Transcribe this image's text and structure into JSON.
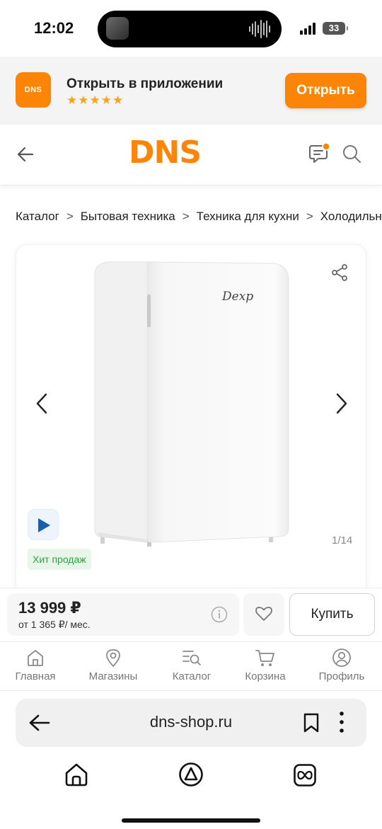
{
  "status_bar": {
    "time": "12:02",
    "battery": "33"
  },
  "app_banner": {
    "logo_text": "DNS",
    "title": "Открыть в приложении",
    "stars": "★★★★★",
    "open_button": "Открыть",
    "accent_color": "#fc8507"
  },
  "header": {
    "brand": "DNS",
    "icons": [
      "back-arrow-icon",
      "chat-icon",
      "search-icon"
    ]
  },
  "breadcrumb": [
    "Каталог",
    "Бытовая техника",
    "Техника для кухни",
    "Холодильное"
  ],
  "product": {
    "image_logo": "Dexp",
    "counter": "1/14",
    "badge": "Хит продаж",
    "price": "13 999 ₽",
    "installment": "от 1 365 ₽/ мес.",
    "buy_button": "Купить"
  },
  "bottom_nav": [
    {
      "label": "Главная",
      "icon": "home-icon"
    },
    {
      "label": "Магазины",
      "icon": "location-pin-icon"
    },
    {
      "label": "Каталог",
      "icon": "catalog-search-icon"
    },
    {
      "label": "Корзина",
      "icon": "cart-icon"
    },
    {
      "label": "Профиль",
      "icon": "profile-icon"
    }
  ],
  "browser": {
    "url": "dns-shop.ru"
  }
}
